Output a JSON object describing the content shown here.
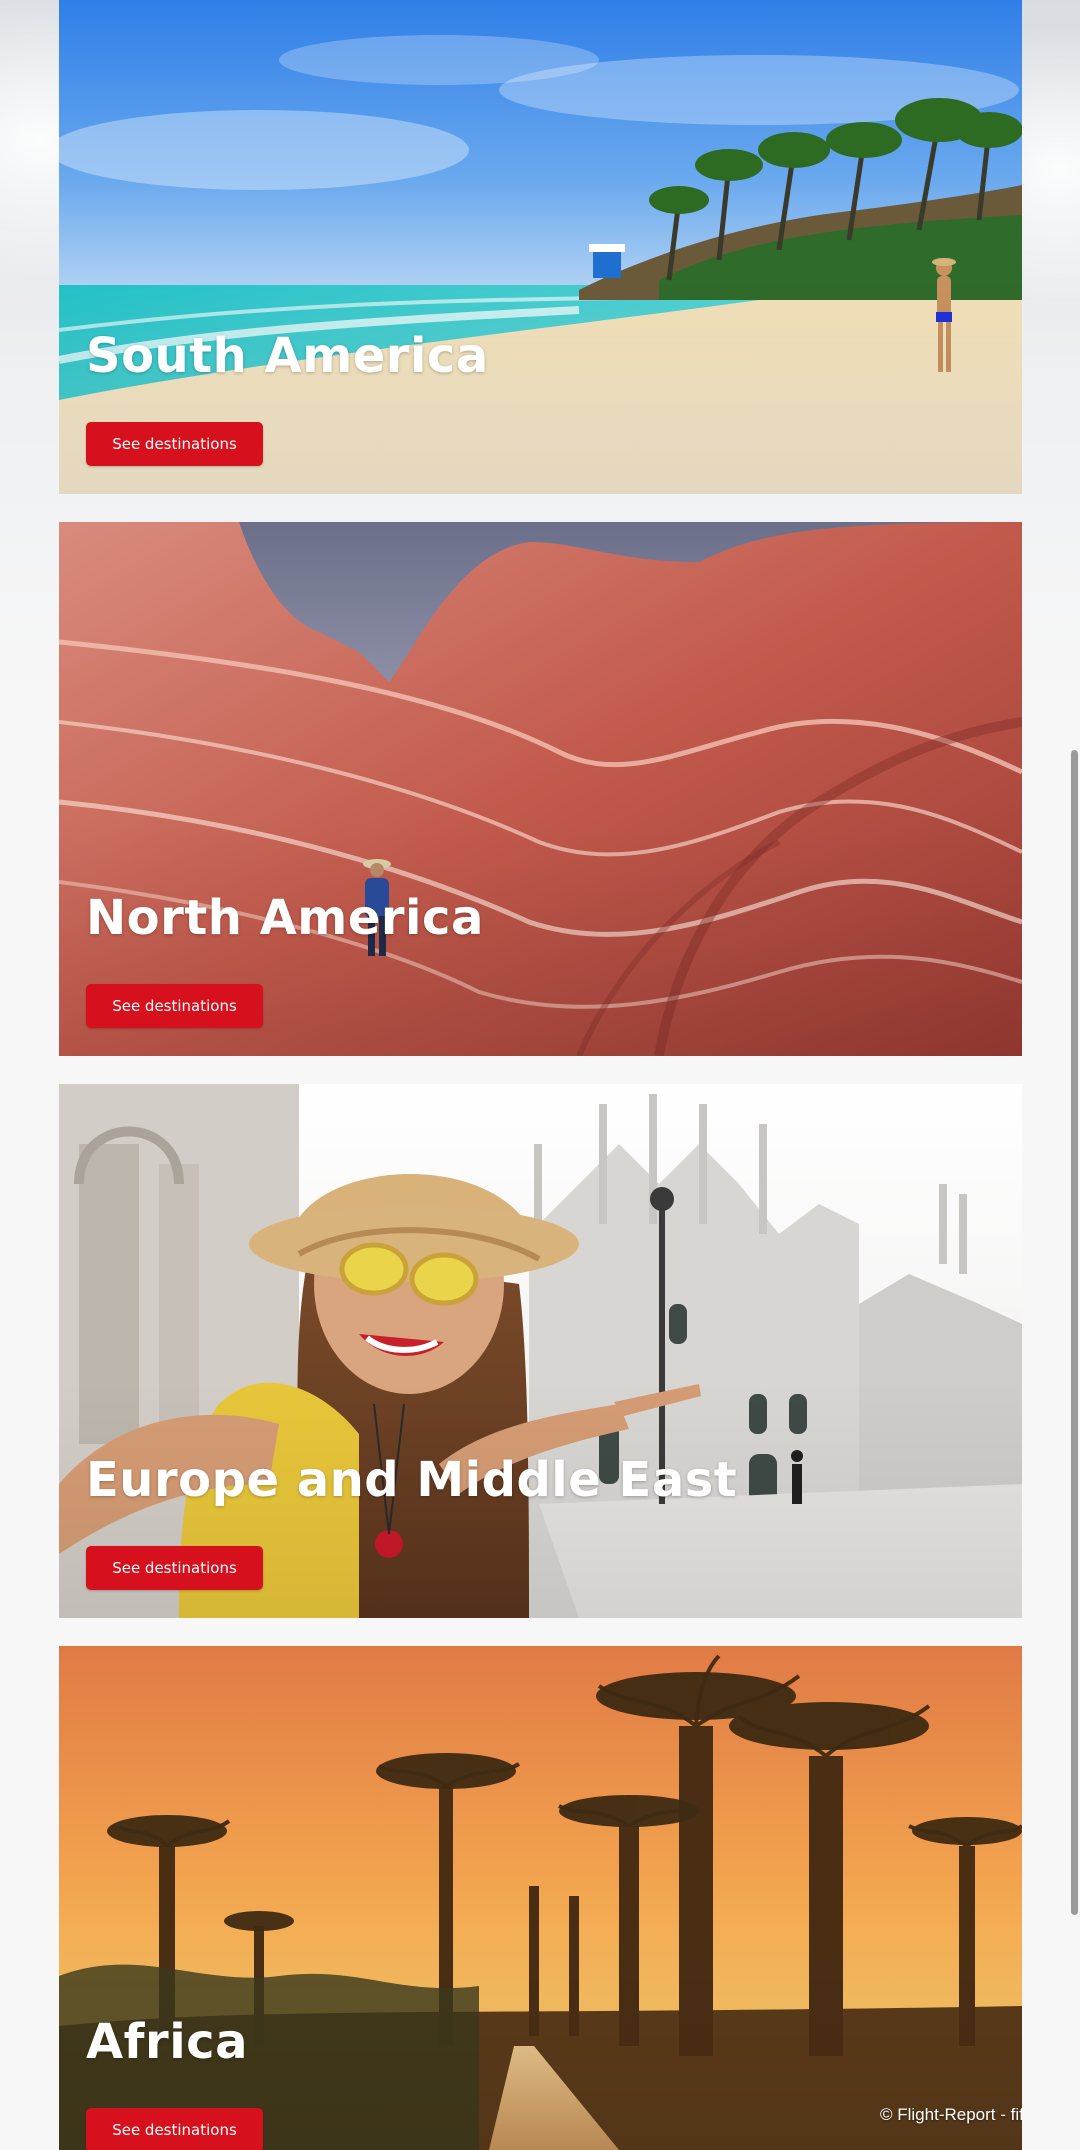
{
  "regions": [
    {
      "title": "South America",
      "button_label": "See destinations"
    },
    {
      "title": "North America",
      "button_label": "See destinations"
    },
    {
      "title": "Europe and Middle East",
      "button_label": "See destinations"
    },
    {
      "title": "Africa",
      "button_label": "See destinations"
    }
  ],
  "footer": {
    "copyright": "© Flight-Report - fift"
  },
  "colors": {
    "button": "#d7101d",
    "title_text": "#ffffff"
  }
}
